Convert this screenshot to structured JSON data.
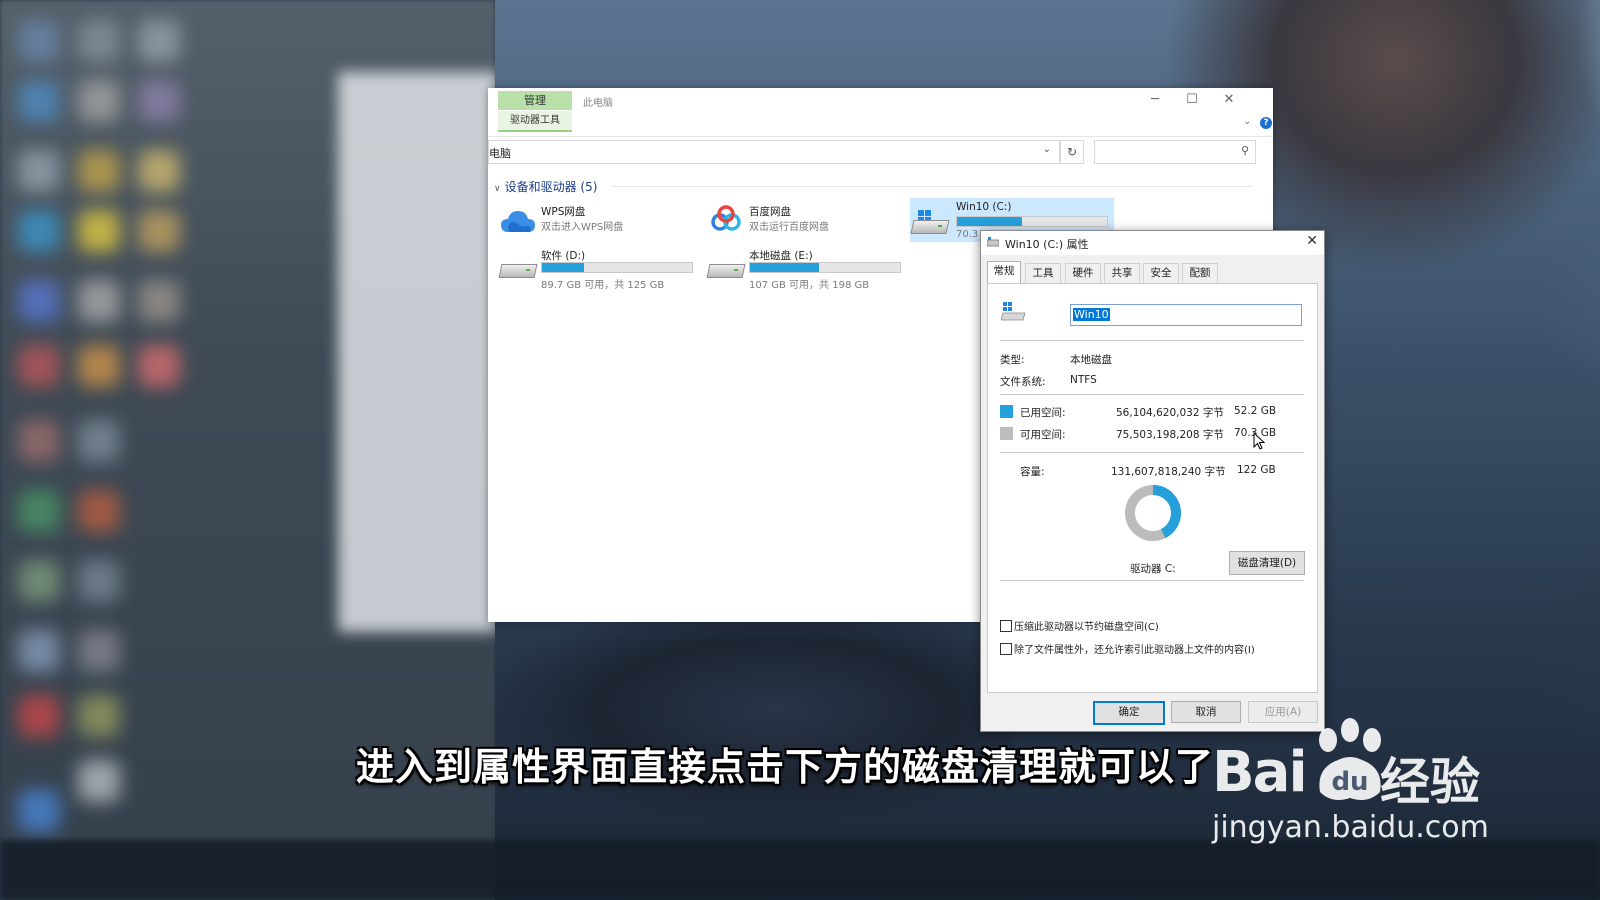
{
  "explorer": {
    "ribbon": {
      "manage_tab": "管理",
      "drive_tools_tab": "驱动器工具",
      "window_title": "此电脑"
    },
    "address": "电脑",
    "section_header": "设备和驱动器 (5)",
    "items": [
      {
        "name": "WPS网盘",
        "sub": "双击进入WPS网盘"
      },
      {
        "name": "百度网盘",
        "sub": "双击运行百度网盘"
      },
      {
        "name": "Win10 (C:)",
        "sub": "70.3",
        "used_fraction": 0.43
      },
      {
        "name": "软件 (D:)",
        "sub": "89.7 GB 可用，共 125 GB",
        "used_fraction": 0.28
      },
      {
        "name": "本地磁盘 (E:)",
        "sub": "107 GB 可用，共 198 GB",
        "used_fraction": 0.46
      }
    ]
  },
  "dialog": {
    "title": "Win10 (C:) 属性",
    "tabs": [
      "常规",
      "工具",
      "硬件",
      "共享",
      "安全",
      "配额"
    ],
    "active_tab": "常规",
    "volume_name": "Win10",
    "type_label": "类型:",
    "type_value": "本地磁盘",
    "fs_label": "文件系统:",
    "fs_value": "NTFS",
    "used_label": "已用空间:",
    "used_bytes": "56,104,620,032 字节",
    "used_gb": "52.2 GB",
    "free_label": "可用空间:",
    "free_bytes": "75,503,198,208 字节",
    "free_gb": "70.3 GB",
    "capacity_label": "容量:",
    "capacity_bytes": "131,607,818,240 字节",
    "capacity_gb": "122 GB",
    "used_fraction": 0.426,
    "drive_label": "驱动器 C:",
    "cleanup_button": "磁盘清理(D)",
    "compress_checkbox": "压缩此驱动器以节约磁盘空间(C)",
    "index_checkbox": "除了文件属性外，还允许索引此驱动器上文件的内容(I)",
    "ok_button": "确定",
    "cancel_button": "取消",
    "apply_button": "应用(A)",
    "colors": {
      "used": "#26a0da",
      "free": "#bcbcbc"
    }
  },
  "caption": "进入到属性界面直接点击下方的磁盘清理就可以了",
  "watermark": {
    "logo_left": "Bai",
    "logo_cn": "经验",
    "url": "jingyan.baidu.com"
  }
}
